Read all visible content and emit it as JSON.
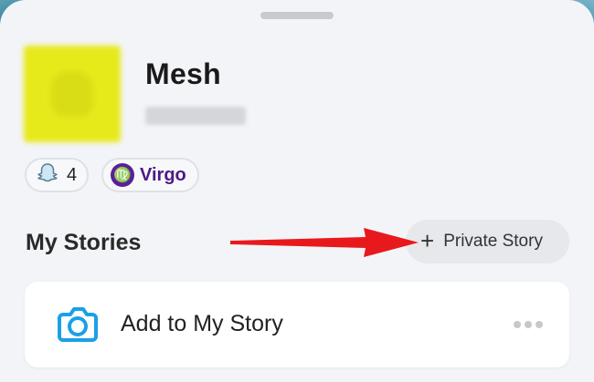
{
  "profile": {
    "name": "Mesh",
    "snap_score": "4",
    "zodiac_label": "Virgo",
    "zodiac_symbol": "♍"
  },
  "stories": {
    "title": "My Stories",
    "private_plus": "+",
    "private_label": "Private Story",
    "add_label": "Add to My Story"
  },
  "icons": {
    "score": "ghost-icon",
    "zodiac": "virgo-icon",
    "camera": "camera-icon",
    "more": "more-icon",
    "annotation": "red-arrow"
  },
  "colors": {
    "accent_blue": "#1ba0e6",
    "zodiac_purple": "#5b1f9a",
    "arrow_red": "#e8191c"
  }
}
